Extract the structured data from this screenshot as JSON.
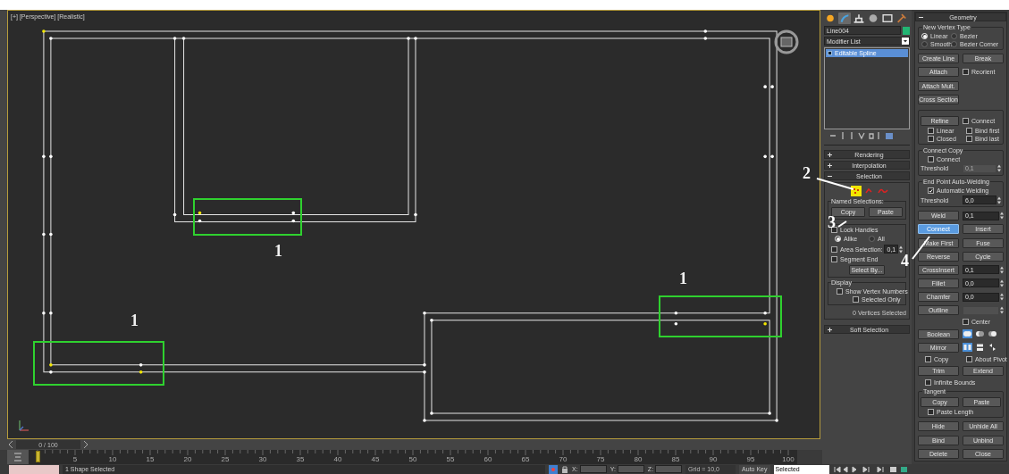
{
  "viewport": {
    "label": "[+] [Perspective] [Realistic]"
  },
  "annotations": [
    {
      "text": "1"
    },
    {
      "text": "1"
    },
    {
      "text": "1"
    },
    {
      "text": "2"
    },
    {
      "text": "3"
    },
    {
      "text": "4"
    }
  ],
  "command_panel": {
    "tabs": [
      {
        "selected": false
      },
      {
        "selected": true
      },
      {
        "selected": false
      },
      {
        "selected": false
      },
      {
        "selected": false
      },
      {
        "selected": false
      }
    ],
    "object_name": "Line004",
    "modifier_list": "Modifier List",
    "stack": [
      {
        "label": "Editable Spline",
        "selected": true
      }
    ],
    "rollouts": [
      {
        "label": "Rendering",
        "expanded": false
      },
      {
        "label": "Interpolation",
        "expanded": false
      },
      {
        "label": "Selection",
        "expanded": true
      }
    ],
    "selection": {
      "levels": [
        {
          "kind": "vertex",
          "selected": true
        },
        {
          "kind": "segment",
          "selected": false
        },
        {
          "kind": "spline",
          "selected": false
        }
      ],
      "named_selections": {
        "title": "Named Selections:",
        "buttons": [
          "Copy",
          "Paste"
        ]
      },
      "lock_handles": {
        "label": "Lock Handles",
        "checked": false
      },
      "handle_mode": [
        {
          "label": "Alike",
          "selected": true
        },
        {
          "label": "All",
          "selected": false
        }
      ],
      "area_selection": {
        "label": "Area Selection:",
        "checked": false,
        "value": "0,1"
      },
      "segment_end": {
        "label": "Segment End",
        "checked": false
      },
      "select_by": "Select By...",
      "display": {
        "title": "Display",
        "show_vertex_numbers": {
          "label": "Show Vertex Numbers",
          "checked": false
        },
        "selected_only": {
          "label": "Selected Only",
          "checked": false
        }
      },
      "status": "0 Vertices Selected"
    },
    "soft_selection": {
      "label": "Soft Selection",
      "expanded": false
    }
  },
  "geometry": {
    "title": "Geometry",
    "expanded": true,
    "rows": [
      {
        "kind": "group",
        "title": "New Vertex Type",
        "rows": [
          {
            "kind": "radios",
            "options": [
              {
                "label": "Linear",
                "selected": true
              },
              {
                "label": "Bezier",
                "selected": false
              }
            ]
          },
          {
            "kind": "radios",
            "options": [
              {
                "label": "Smooth",
                "selected": false
              },
              {
                "label": "Bezier Corner",
                "selected": false
              }
            ]
          }
        ]
      },
      {
        "kind": "pair",
        "buttons": [
          {
            "label": "Create Line",
            "active": false
          },
          {
            "label": "Break",
            "active": false
          }
        ]
      },
      {
        "kind": "button_check",
        "button": "Attach",
        "check": {
          "label": "Reorient",
          "checked": false
        }
      },
      {
        "kind": "single",
        "button": "Attach Mult."
      },
      {
        "kind": "single",
        "button": "Cross Section"
      },
      {
        "kind": "group",
        "rows": [
          {
            "kind": "button_check",
            "button": "Refine",
            "check": {
              "label": "Connect",
              "checked": false
            }
          },
          {
            "kind": "checks",
            "checks": [
              {
                "label": "Linear",
                "checked": false
              },
              {
                "label": "Bind first",
                "checked": false
              }
            ]
          },
          {
            "kind": "checks",
            "checks": [
              {
                "label": "Closed",
                "checked": false
              },
              {
                "label": "Bind last",
                "checked": false
              }
            ]
          }
        ]
      },
      {
        "kind": "group",
        "title": "Connect Copy",
        "rows": [
          {
            "kind": "checks",
            "checks": [
              {
                "label": "Connect",
                "checked": false
              }
            ]
          },
          {
            "kind": "spinner",
            "label": "Threshold",
            "value": "0,1",
            "disabled": true
          }
        ]
      },
      {
        "kind": "group",
        "title": "End Point Auto-Welding",
        "rows": [
          {
            "kind": "checks",
            "checks": [
              {
                "label": "Automatic Welding",
                "checked": true
              }
            ]
          },
          {
            "kind": "spinner",
            "label": "Threshold",
            "value": "6,0",
            "disabled": false
          }
        ]
      },
      {
        "kind": "button_spinner",
        "button": "Weld",
        "value": "0,1",
        "disabled": false
      },
      {
        "kind": "pair",
        "buttons": [
          {
            "label": "Connect",
            "active": true
          },
          {
            "label": "Insert",
            "active": false
          }
        ]
      },
      {
        "kind": "pair",
        "buttons": [
          {
            "label": "Make First",
            "active": false
          },
          {
            "label": "Fuse",
            "active": false
          }
        ]
      },
      {
        "kind": "pair",
        "buttons": [
          {
            "label": "Reverse",
            "active": false
          },
          {
            "label": "Cycle",
            "active": false
          }
        ]
      },
      {
        "kind": "button_spinner",
        "button": "CrossInsert",
        "value": "0,1",
        "disabled": false
      },
      {
        "kind": "button_spinner",
        "button": "Fillet",
        "value": "0,0",
        "disabled": false
      },
      {
        "kind": "button_spinner",
        "button": "Chamfer",
        "value": "0,0",
        "disabled": false
      },
      {
        "kind": "button_spinner",
        "button": "Outline",
        "disabled": true
      },
      {
        "kind": "check_right",
        "check": {
          "label": "Center",
          "checked": false
        }
      },
      {
        "kind": "button_icons",
        "button": "Boolean",
        "icons": [
          {
            "kind": "union",
            "selected": true
          },
          {
            "kind": "subtract",
            "selected": false
          },
          {
            "kind": "intersect",
            "selected": false
          }
        ]
      },
      {
        "kind": "button_icons",
        "button": "Mirror",
        "icons": [
          {
            "kind": "mirror_h",
            "selected": true
          },
          {
            "kind": "mirror_v",
            "selected": false
          },
          {
            "kind": "mirror_both",
            "selected": false
          }
        ]
      },
      {
        "kind": "checks",
        "checks": [
          {
            "label": "Copy",
            "checked": false
          },
          {
            "label": "About Pivot",
            "checked": false
          }
        ]
      },
      {
        "kind": "pair",
        "buttons": [
          {
            "label": "Trim",
            "active": false
          },
          {
            "label": "Extend",
            "active": false
          }
        ]
      },
      {
        "kind": "checks",
        "checks": [
          {
            "label": "Infinite Bounds",
            "checked": false
          }
        ]
      },
      {
        "kind": "group",
        "title": "Tangent",
        "rows": [
          {
            "kind": "pair",
            "buttons": [
              {
                "label": "Copy",
                "active": false
              },
              {
                "label": "Paste",
                "active": false
              }
            ]
          },
          {
            "kind": "checks",
            "checks": [
              {
                "label": "Paste Length",
                "checked": false
              }
            ]
          }
        ]
      },
      {
        "kind": "pair",
        "buttons": [
          {
            "label": "Hide",
            "active": false
          },
          {
            "label": "Unhide All",
            "active": false
          }
        ]
      },
      {
        "kind": "pair",
        "buttons": [
          {
            "label": "Bind",
            "active": false
          },
          {
            "label": "Unbind",
            "active": false
          }
        ]
      },
      {
        "kind": "pair",
        "buttons": [
          {
            "label": "Delete",
            "active": false
          },
          {
            "label": "Close",
            "active": false
          }
        ]
      }
    ]
  },
  "time_slider": {
    "label": "0 / 100"
  },
  "track_bar": {
    "labels": [
      "5",
      "10",
      "15",
      "20",
      "25",
      "30",
      "35",
      "40",
      "45",
      "50",
      "55",
      "60",
      "65",
      "70",
      "75",
      "80",
      "85",
      "90",
      "95",
      "100"
    ]
  },
  "status_bar": {
    "prompt": "1 Shape Selected",
    "coords": [
      {
        "label": "X:"
      },
      {
        "label": "Y:"
      },
      {
        "label": "Z:"
      }
    ],
    "grid": "Grid = 10,0",
    "auto_key": "Auto Key",
    "key_filter": "Selected"
  }
}
